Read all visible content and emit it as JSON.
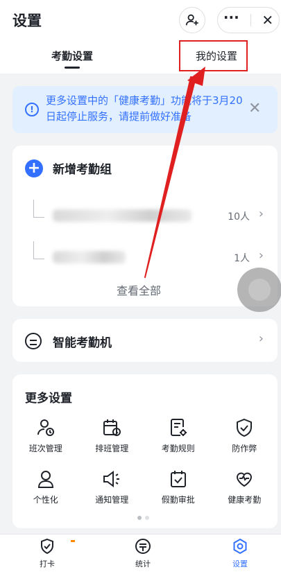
{
  "header": {
    "title": "设置",
    "more_icon": "more-dots-icon",
    "close_icon": "close-icon"
  },
  "tabs": [
    {
      "label": "考勤设置",
      "active": true
    },
    {
      "label": "我的设置",
      "active": false
    }
  ],
  "notice": {
    "text": "更多设置中的「健康考勤」功能将于3月20日起停止服务，请提前做好准备"
  },
  "groups": {
    "add_label": "新增考勤组",
    "items": [
      {
        "count": "10人"
      },
      {
        "count": "1人"
      }
    ],
    "view_all": "查看全部"
  },
  "machine": {
    "label": "智能考勤机"
  },
  "more_settings": {
    "title": "更多设置",
    "items": [
      {
        "label": "班次管理",
        "icon": "shift-icon"
      },
      {
        "label": "排班管理",
        "icon": "schedule-icon"
      },
      {
        "label": "考勤规则",
        "icon": "rules-icon"
      },
      {
        "label": "防作弊",
        "icon": "shield-icon"
      },
      {
        "label": "个性化",
        "icon": "person-icon"
      },
      {
        "label": "通知管理",
        "icon": "megaphone-icon"
      },
      {
        "label": "假勤审批",
        "icon": "approval-icon"
      },
      {
        "label": "健康考勤",
        "icon": "heart-icon"
      }
    ],
    "page_count": 2,
    "current_page": 1
  },
  "bottom_nav": [
    {
      "label": "打卡",
      "icon": "checkin-icon",
      "active": false
    },
    {
      "label": "统计",
      "icon": "stats-icon",
      "active": false
    },
    {
      "label": "设置",
      "icon": "settings-gear-icon",
      "active": true
    }
  ],
  "colors": {
    "accent": "#3370ff",
    "annotation_red": "#e02020",
    "notice_bg": "#e1efff"
  }
}
